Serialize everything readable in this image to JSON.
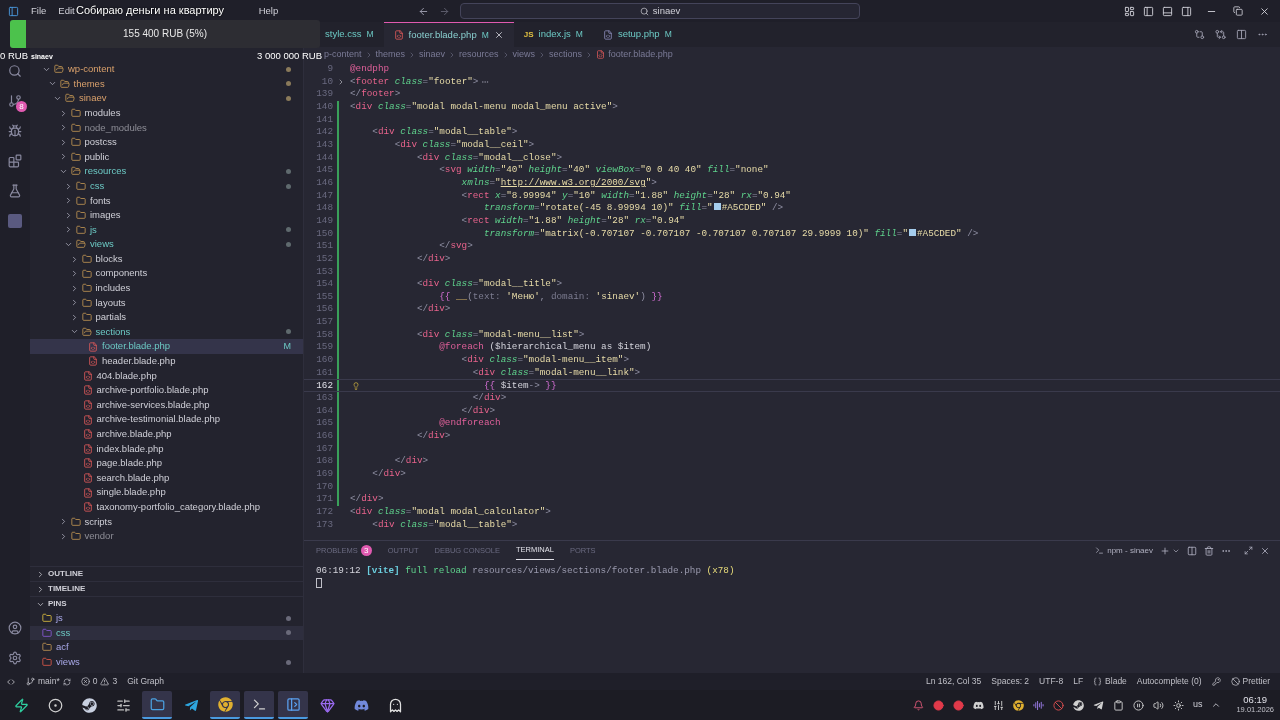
{
  "overlay": {
    "title": "Собираю деньги на квартиру",
    "amount": "155 400 RUB (5%)",
    "level": 0.05,
    "start": "0 RUB",
    "user": "sinaev",
    "goal": "3 000 000 RUB"
  },
  "menu": [
    "File",
    "Edit",
    "Help"
  ],
  "search": {
    "value": "sinaev"
  },
  "activity": {
    "scm_badge": "8"
  },
  "explorer": {
    "tree": [
      {
        "name": "wp-content",
        "kind": "folder",
        "expanded": true,
        "ignored": false,
        "modified": false,
        "contains_changes": true,
        "dot": true,
        "selected": false,
        "children": [
          {
            "name": "themes",
            "kind": "folder",
            "expanded": true,
            "ignored": false,
            "modified": false,
            "contains_changes": true,
            "dot": true,
            "selected": false,
            "children": [
              {
                "name": "sinaev",
                "kind": "folder",
                "expanded": true,
                "ignored": false,
                "modified": false,
                "contains_changes": true,
                "dot": true,
                "selected": false,
                "children": [
                  {
                    "name": "modules",
                    "kind": "folder",
                    "expanded": false,
                    "ignored": false,
                    "modified": false,
                    "contains_changes": false,
                    "dot": false,
                    "selected": false
                  },
                  {
                    "name": "node_modules",
                    "kind": "folder",
                    "expanded": false,
                    "ignored": true,
                    "modified": false,
                    "contains_changes": false,
                    "dot": false,
                    "selected": false
                  },
                  {
                    "name": "postcss",
                    "kind": "folder",
                    "expanded": false,
                    "ignored": false,
                    "modified": false,
                    "contains_changes": false,
                    "dot": false,
                    "selected": false
                  },
                  {
                    "name": "public",
                    "kind": "folder",
                    "expanded": false,
                    "ignored": false,
                    "modified": false,
                    "contains_changes": false,
                    "dot": false,
                    "selected": false
                  },
                  {
                    "name": "resources",
                    "kind": "folder",
                    "expanded": true,
                    "ignored": false,
                    "modified": true,
                    "contains_changes": false,
                    "dot": true,
                    "selected": false,
                    "children": [
                      {
                        "name": "css",
                        "kind": "folder",
                        "expanded": false,
                        "ignored": false,
                        "modified": true,
                        "contains_changes": false,
                        "dot": true,
                        "selected": false
                      },
                      {
                        "name": "fonts",
                        "kind": "folder",
                        "expanded": false,
                        "ignored": false,
                        "modified": false,
                        "contains_changes": false,
                        "dot": false,
                        "selected": false
                      },
                      {
                        "name": "images",
                        "kind": "folder",
                        "expanded": false,
                        "ignored": false,
                        "modified": false,
                        "contains_changes": false,
                        "dot": false,
                        "selected": false
                      },
                      {
                        "name": "js",
                        "kind": "folder",
                        "expanded": false,
                        "ignored": false,
                        "modified": true,
                        "contains_changes": false,
                        "dot": true,
                        "selected": false
                      },
                      {
                        "name": "views",
                        "kind": "folder",
                        "expanded": true,
                        "ignored": false,
                        "modified": true,
                        "contains_changes": false,
                        "dot": true,
                        "selected": false,
                        "children": [
                          {
                            "name": "blocks",
                            "kind": "folder",
                            "expanded": false,
                            "ignored": false,
                            "modified": false,
                            "contains_changes": false,
                            "dot": false,
                            "selected": false
                          },
                          {
                            "name": "components",
                            "kind": "folder",
                            "expanded": false,
                            "ignored": false,
                            "modified": false,
                            "contains_changes": false,
                            "dot": false,
                            "selected": false
                          },
                          {
                            "name": "includes",
                            "kind": "folder",
                            "expanded": false,
                            "ignored": false,
                            "modified": false,
                            "contains_changes": false,
                            "dot": false,
                            "selected": false
                          },
                          {
                            "name": "layouts",
                            "kind": "folder",
                            "expanded": false,
                            "ignored": false,
                            "modified": false,
                            "contains_changes": false,
                            "dot": false,
                            "selected": false
                          },
                          {
                            "name": "partials",
                            "kind": "folder",
                            "expanded": false,
                            "ignored": false,
                            "modified": false,
                            "contains_changes": false,
                            "dot": false,
                            "selected": false
                          },
                          {
                            "name": "sections",
                            "kind": "folder",
                            "expanded": true,
                            "ignored": false,
                            "modified": true,
                            "contains_changes": false,
                            "dot": true,
                            "selected": false,
                            "children": [
                              {
                                "name": "footer.blade.php",
                                "kind": "file",
                                "ignored": false,
                                "modified": true,
                                "dot": false,
                                "selected": true,
                                "badge": "M"
                              },
                              {
                                "name": "header.blade.php",
                                "kind": "file",
                                "ignored": false,
                                "modified": false,
                                "contains_changes": false,
                                "dot": false,
                                "selected": false
                              }
                            ]
                          },
                          {
                            "name": "404.blade.php",
                            "kind": "file",
                            "ignored": false,
                            "modified": false,
                            "contains_changes": false,
                            "dot": false,
                            "selected": false
                          },
                          {
                            "name": "archive-portfolio.blade.php",
                            "kind": "file",
                            "ignored": false,
                            "modified": false,
                            "contains_changes": false,
                            "dot": false,
                            "selected": false
                          },
                          {
                            "name": "archive-services.blade.php",
                            "kind": "file",
                            "ignored": false,
                            "modified": false,
                            "contains_changes": false,
                            "dot": false,
                            "selected": false
                          },
                          {
                            "name": "archive-testimonial.blade.php",
                            "kind": "file",
                            "ignored": false,
                            "modified": false,
                            "contains_changes": false,
                            "dot": false,
                            "selected": false
                          },
                          {
                            "name": "archive.blade.php",
                            "kind": "file",
                            "ignored": false,
                            "modified": false,
                            "contains_changes": false,
                            "dot": false,
                            "selected": false
                          },
                          {
                            "name": "index.blade.php",
                            "kind": "file",
                            "ignored": false,
                            "modified": false,
                            "contains_changes": false,
                            "dot": false,
                            "selected": false
                          },
                          {
                            "name": "page.blade.php",
                            "kind": "file",
                            "ignored": false,
                            "modified": false,
                            "contains_changes": false,
                            "dot": false,
                            "selected": false
                          },
                          {
                            "name": "search.blade.php",
                            "kind": "file",
                            "ignored": false,
                            "modified": false,
                            "contains_changes": false,
                            "dot": false,
                            "selected": false
                          },
                          {
                            "name": "single.blade.php",
                            "kind": "file",
                            "ignored": false,
                            "modified": false,
                            "contains_changes": false,
                            "dot": false,
                            "selected": false
                          },
                          {
                            "name": "taxonomy-portfolio_category.blade.php",
                            "kind": "file",
                            "ignored": false,
                            "modified": false,
                            "contains_changes": false,
                            "dot": false,
                            "selected": false
                          }
                        ]
                      }
                    ]
                  },
                  {
                    "name": "scripts",
                    "kind": "folder",
                    "expanded": false,
                    "ignored": false,
                    "modified": false,
                    "contains_changes": false,
                    "dot": false,
                    "selected": false
                  },
                  {
                    "name": "vendor",
                    "kind": "folder",
                    "expanded": false,
                    "ignored": true,
                    "modified": false,
                    "contains_changes": false,
                    "dot": false,
                    "selected": false
                  }
                ]
              }
            ]
          }
        ]
      }
    ]
  },
  "sections": [
    {
      "title": "OUTLINE",
      "expanded": false
    },
    {
      "title": "TIMELINE",
      "expanded": false
    },
    {
      "title": "PINS",
      "expanded": true
    }
  ],
  "pins": [
    {
      "name": "js",
      "kind": "js",
      "dot": true,
      "selected": false
    },
    {
      "name": "css",
      "kind": "css",
      "dot": true,
      "selected": true
    },
    {
      "name": "acf",
      "kind": "folder",
      "dot": false,
      "selected": false
    },
    {
      "name": "views",
      "kind": "views",
      "dot": true,
      "selected": false
    }
  ],
  "tabs": [
    {
      "label": "style.css",
      "kind": "hidden",
      "badge": "M",
      "selected": false
    },
    {
      "label": "footer.blade.php",
      "kind": "blade",
      "badge": "M",
      "selected": true
    },
    {
      "label": "index.js",
      "kind": "js",
      "icon_text": "JS",
      "badge": "M",
      "selected": false
    },
    {
      "label": "setup.php",
      "kind": "php",
      "badge": "M",
      "selected": false
    }
  ],
  "breadcrumb": [
    "p-content",
    "themes",
    "sinaev",
    "resources",
    "views",
    "sections",
    "footer.blade.php"
  ],
  "lines": [
    {
      "n": "9",
      "mod": false,
      "folded": false,
      "current": false,
      "code": [
        {
          "kind": "dir",
          "text": "@endphp"
        }
      ]
    },
    {
      "n": "10",
      "mod": false,
      "folded": true,
      "current": false,
      "code": [
        {
          "kind": "punct",
          "text": "<"
        },
        {
          "kind": "tag",
          "text": "footer"
        },
        {
          "kind": "attr",
          "text": " class"
        },
        {
          "kind": "punct",
          "text": "="
        },
        {
          "kind": "str",
          "text": "\"footer\""
        },
        {
          "kind": "punct",
          "text": ">"
        }
      ]
    },
    {
      "n": "139",
      "mod": false,
      "folded": false,
      "current": false,
      "code": [
        {
          "kind": "punct",
          "text": "</"
        },
        {
          "kind": "tag",
          "text": "footer"
        },
        {
          "kind": "punct",
          "text": ">"
        }
      ]
    },
    {
      "n": "140",
      "mod": true,
      "folded": false,
      "current": false,
      "code": [
        {
          "kind": "punct",
          "text": "<"
        },
        {
          "kind": "tag",
          "text": "div"
        },
        {
          "kind": "attr",
          "text": " class"
        },
        {
          "kind": "punct",
          "text": "="
        },
        {
          "kind": "str",
          "text": "\"modal modal-menu modal_menu active\""
        },
        {
          "kind": "punct",
          "text": ">"
        }
      ]
    },
    {
      "n": "141",
      "mod": true,
      "folded": false,
      "current": false
    },
    {
      "n": "142",
      "mod": true,
      "folded": false,
      "current": false,
      "code": [
        {
          "kind": "punct",
          "text": "    <"
        },
        {
          "kind": "tag",
          "text": "div"
        },
        {
          "kind": "attr",
          "text": " class"
        },
        {
          "kind": "punct",
          "text": "="
        },
        {
          "kind": "str",
          "text": "\"modal__table\""
        },
        {
          "kind": "punct",
          "text": ">"
        }
      ]
    },
    {
      "n": "143",
      "mod": true,
      "folded": false,
      "current": false,
      "code": [
        {
          "kind": "punct",
          "text": "        <"
        },
        {
          "kind": "tag",
          "text": "div"
        },
        {
          "kind": "attr",
          "text": " class"
        },
        {
          "kind": "punct",
          "text": "="
        },
        {
          "kind": "str",
          "text": "\"modal__ceil\""
        },
        {
          "kind": "punct",
          "text": ">"
        }
      ]
    },
    {
      "n": "144",
      "mod": true,
      "folded": false,
      "current": false,
      "code": [
        {
          "kind": "punct",
          "text": "            <"
        },
        {
          "kind": "tag",
          "text": "div"
        },
        {
          "kind": "attr",
          "text": " class"
        },
        {
          "kind": "punct",
          "text": "="
        },
        {
          "kind": "str",
          "text": "\"modal__close\""
        },
        {
          "kind": "punct",
          "text": ">"
        }
      ]
    },
    {
      "n": "145",
      "mod": true,
      "folded": false,
      "current": false,
      "code": [
        {
          "kind": "punct",
          "text": "                <"
        },
        {
          "kind": "tag",
          "text": "svg"
        },
        {
          "kind": "attr",
          "text": " width"
        },
        {
          "kind": "punct",
          "text": "="
        },
        {
          "kind": "str",
          "text": "\"40\""
        },
        {
          "kind": "attr",
          "text": " height"
        },
        {
          "kind": "punct",
          "text": "="
        },
        {
          "kind": "str",
          "text": "\"40\""
        },
        {
          "kind": "attr",
          "text": " viewBox"
        },
        {
          "kind": "punct",
          "text": "="
        },
        {
          "kind": "str",
          "text": "\"0 0 40 40\""
        },
        {
          "kind": "attr",
          "text": " fill"
        },
        {
          "kind": "punct",
          "text": "="
        },
        {
          "kind": "str",
          "text": "\"none\""
        }
      ]
    },
    {
      "n": "146",
      "mod": true,
      "folded": false,
      "current": false,
      "code": [
        {
          "kind": "attr",
          "text": "                    xmlns"
        },
        {
          "kind": "punct",
          "text": "="
        },
        {
          "kind": "str",
          "text": "\""
        },
        {
          "kind": "url",
          "text": "http://www.w3.org/2000/svg"
        },
        {
          "kind": "str",
          "text": "\""
        },
        {
          "kind": "punct",
          "text": ">"
        }
      ]
    },
    {
      "n": "147",
      "mod": true,
      "folded": false,
      "current": false,
      "code": [
        {
          "kind": "punct",
          "text": "                    <"
        },
        {
          "kind": "tag",
          "text": "rect"
        },
        {
          "kind": "attr",
          "text": " x"
        },
        {
          "kind": "punct",
          "text": "="
        },
        {
          "kind": "str",
          "text": "\"8.99994\""
        },
        {
          "kind": "attr",
          "text": " y"
        },
        {
          "kind": "punct",
          "text": "="
        },
        {
          "kind": "str",
          "text": "\"10\""
        },
        {
          "kind": "attr",
          "text": " width"
        },
        {
          "kind": "punct",
          "text": "="
        },
        {
          "kind": "str",
          "text": "\"1.88\""
        },
        {
          "kind": "attr",
          "text": " height"
        },
        {
          "kind": "punct",
          "text": "="
        },
        {
          "kind": "str",
          "text": "\"28\""
        },
        {
          "kind": "attr",
          "text": " rx"
        },
        {
          "kind": "punct",
          "text": "="
        },
        {
          "kind": "str",
          "text": "\"0.94\""
        }
      ]
    },
    {
      "n": "148",
      "mod": true,
      "folded": false,
      "current": false,
      "code": [
        {
          "kind": "attr",
          "text": "                        transform"
        },
        {
          "kind": "punct",
          "text": "="
        },
        {
          "kind": "str",
          "text": "\"rotate(-45 8.99994 10)\""
        },
        {
          "kind": "attr",
          "text": " fill"
        },
        {
          "kind": "punct",
          "text": "="
        },
        {
          "kind": "str",
          "text": "\""
        },
        {
          "kind": "swatch",
          "color": "#a5cded"
        },
        {
          "kind": "str",
          "text": "#A5CDED\""
        },
        {
          "kind": "punct",
          "text": " />"
        }
      ]
    },
    {
      "n": "149",
      "mod": true,
      "folded": false,
      "current": false,
      "code": [
        {
          "kind": "punct",
          "text": "                    <"
        },
        {
          "kind": "tag",
          "text": "rect"
        },
        {
          "kind": "attr",
          "text": " width"
        },
        {
          "kind": "punct",
          "text": "="
        },
        {
          "kind": "str",
          "text": "\"1.88\""
        },
        {
          "kind": "attr",
          "text": " height"
        },
        {
          "kind": "punct",
          "text": "="
        },
        {
          "kind": "str",
          "text": "\"28\""
        },
        {
          "kind": "attr",
          "text": " rx"
        },
        {
          "kind": "punct",
          "text": "="
        },
        {
          "kind": "str",
          "text": "\"0.94\""
        }
      ]
    },
    {
      "n": "150",
      "mod": true,
      "folded": false,
      "current": false,
      "code": [
        {
          "kind": "attr",
          "text": "                        transform"
        },
        {
          "kind": "punct",
          "text": "="
        },
        {
          "kind": "str",
          "text": "\"matrix(-0.707107 -0.707107 -0.707107 0.707107 29.9999 10)\""
        },
        {
          "kind": "attr",
          "text": " fill"
        },
        {
          "kind": "punct",
          "text": "="
        },
        {
          "kind": "str",
          "text": "\""
        },
        {
          "kind": "swatch",
          "color": "#a5cded"
        },
        {
          "kind": "str",
          "text": "#A5CDED\""
        },
        {
          "kind": "punct",
          "text": " />"
        }
      ]
    },
    {
      "n": "151",
      "mod": true,
      "folded": false,
      "current": false,
      "code": [
        {
          "kind": "punct",
          "text": "                </"
        },
        {
          "kind": "tag",
          "text": "svg"
        },
        {
          "kind": "punct",
          "text": ">"
        }
      ]
    },
    {
      "n": "152",
      "mod": true,
      "folded": false,
      "current": false,
      "code": [
        {
          "kind": "punct",
          "text": "            </"
        },
        {
          "kind": "tag",
          "text": "div"
        },
        {
          "kind": "punct",
          "text": ">"
        }
      ]
    },
    {
      "n": "153",
      "mod": true,
      "folded": false,
      "current": false
    },
    {
      "n": "154",
      "mod": true,
      "folded": false,
      "current": false,
      "code": [
        {
          "kind": "punct",
          "text": "            <"
        },
        {
          "kind": "tag",
          "text": "div"
        },
        {
          "kind": "attr",
          "text": " class"
        },
        {
          "kind": "punct",
          "text": "="
        },
        {
          "kind": "str",
          "text": "\"modal__title\""
        },
        {
          "kind": "punct",
          "text": ">"
        }
      ]
    },
    {
      "n": "155",
      "mod": true,
      "folded": false,
      "current": false,
      "code": [
        {
          "kind": "brace",
          "text": "                {{ "
        },
        {
          "kind": "fn",
          "text": "__"
        },
        {
          "kind": "punct",
          "text": "("
        },
        {
          "kind": "key",
          "text": "text:"
        },
        {
          "kind": "str",
          "text": " 'Меню'"
        },
        {
          "kind": "punct",
          "text": ", "
        },
        {
          "kind": "key",
          "text": "domain:"
        },
        {
          "kind": "str",
          "text": " 'sinaev'"
        },
        {
          "kind": "punct",
          "text": ")"
        },
        {
          "kind": "brace",
          "text": " }}"
        }
      ]
    },
    {
      "n": "156",
      "mod": true,
      "folded": false,
      "current": false,
      "code": [
        {
          "kind": "punct",
          "text": "            </"
        },
        {
          "kind": "tag",
          "text": "div"
        },
        {
          "kind": "punct",
          "text": ">"
        }
      ]
    },
    {
      "n": "157",
      "mod": true,
      "folded": false,
      "current": false
    },
    {
      "n": "158",
      "mod": true,
      "folded": false,
      "current": false,
      "code": [
        {
          "kind": "punct",
          "text": "            <"
        },
        {
          "kind": "tag",
          "text": "div"
        },
        {
          "kind": "attr",
          "text": " class"
        },
        {
          "kind": "punct",
          "text": "="
        },
        {
          "kind": "str",
          "text": "\"modal-menu__list\""
        },
        {
          "kind": "punct",
          "text": ">"
        }
      ]
    },
    {
      "n": "159",
      "mod": true,
      "folded": false,
      "current": false,
      "code": [
        {
          "kind": "dir",
          "text": "                @foreach"
        },
        {
          "kind": "plain",
          "text": " ($hierarchical_menu as $item)"
        }
      ]
    },
    {
      "n": "160",
      "mod": true,
      "folded": false,
      "current": false,
      "code": [
        {
          "kind": "punct",
          "text": "                    <"
        },
        {
          "kind": "tag",
          "text": "div"
        },
        {
          "kind": "attr",
          "text": " class"
        },
        {
          "kind": "punct",
          "text": "="
        },
        {
          "kind": "str",
          "text": "\"modal-menu__item\""
        },
        {
          "kind": "punct",
          "text": ">"
        }
      ]
    },
    {
      "n": "161",
      "mod": true,
      "folded": false,
      "current": false,
      "code": [
        {
          "kind": "punct",
          "text": "                      <"
        },
        {
          "kind": "tag",
          "text": "div"
        },
        {
          "kind": "attr",
          "text": " class"
        },
        {
          "kind": "punct",
          "text": "="
        },
        {
          "kind": "str",
          "text": "\"modal-menu__link\""
        },
        {
          "kind": "punct",
          "text": ">"
        }
      ]
    },
    {
      "n": "162",
      "mod": true,
      "folded": false,
      "current": true,
      "code": [
        {
          "kind": "brace",
          "text": "                        {{ "
        },
        {
          "kind": "var",
          "text": "$item"
        },
        {
          "kind": "punct",
          "text": "-> "
        },
        {
          "kind": "brace",
          "text": "}}"
        }
      ]
    },
    {
      "n": "163",
      "mod": true,
      "folded": false,
      "current": false,
      "code": [
        {
          "kind": "punct",
          "text": "                      </"
        },
        {
          "kind": "tag",
          "text": "div"
        },
        {
          "kind": "punct",
          "text": ">"
        }
      ]
    },
    {
      "n": "164",
      "mod": true,
      "folded": false,
      "current": false,
      "code": [
        {
          "kind": "punct",
          "text": "                    </"
        },
        {
          "kind": "tag",
          "text": "div"
        },
        {
          "kind": "punct",
          "text": ">"
        }
      ]
    },
    {
      "n": "165",
      "mod": true,
      "folded": false,
      "current": false,
      "code": [
        {
          "kind": "dir",
          "text": "                @endforeach"
        }
      ]
    },
    {
      "n": "166",
      "mod": true,
      "folded": false,
      "current": false,
      "code": [
        {
          "kind": "punct",
          "text": "            </"
        },
        {
          "kind": "tag",
          "text": "div"
        },
        {
          "kind": "punct",
          "text": ">"
        }
      ]
    },
    {
      "n": "167",
      "mod": true,
      "folded": false,
      "current": false
    },
    {
      "n": "168",
      "mod": true,
      "folded": false,
      "current": false,
      "code": [
        {
          "kind": "punct",
          "text": "        </"
        },
        {
          "kind": "tag",
          "text": "div"
        },
        {
          "kind": "punct",
          "text": ">"
        }
      ]
    },
    {
      "n": "169",
      "mod": true,
      "folded": false,
      "current": false,
      "code": [
        {
          "kind": "punct",
          "text": "    </"
        },
        {
          "kind": "tag",
          "text": "div"
        },
        {
          "kind": "punct",
          "text": ">"
        }
      ]
    },
    {
      "n": "170",
      "mod": true,
      "folded": false,
      "current": false
    },
    {
      "n": "171",
      "mod": true,
      "folded": false,
      "current": false,
      "code": [
        {
          "kind": "punct",
          "text": "</"
        },
        {
          "kind": "tag",
          "text": "div"
        },
        {
          "kind": "punct",
          "text": ">"
        }
      ]
    },
    {
      "n": "172",
      "mod": false,
      "folded": false,
      "current": false,
      "code": [
        {
          "kind": "punct",
          "text": "<"
        },
        {
          "kind": "tag",
          "text": "div"
        },
        {
          "kind": "attr",
          "text": " class"
        },
        {
          "kind": "punct",
          "text": "="
        },
        {
          "kind": "str",
          "text": "\"modal modal_calculator\""
        },
        {
          "kind": "punct",
          "text": ">"
        }
      ]
    },
    {
      "n": "173",
      "mod": false,
      "folded": false,
      "current": false,
      "code": [
        {
          "kind": "punct",
          "text": "    <"
        },
        {
          "kind": "tag",
          "text": "div"
        },
        {
          "kind": "attr",
          "text": " class"
        },
        {
          "kind": "punct",
          "text": "="
        },
        {
          "kind": "str",
          "text": "\"modal__table\""
        },
        {
          "kind": "punct",
          "text": ">"
        }
      ]
    }
  ],
  "panel": {
    "tabs": [
      {
        "label": "PROBLEMS",
        "badge": "3",
        "selected": false
      },
      {
        "label": "OUTPUT",
        "selected": false
      },
      {
        "label": "DEBUG CONSOLE",
        "selected": false
      },
      {
        "label": "TERMINAL",
        "selected": true
      },
      {
        "label": "PORTS",
        "selected": false
      }
    ],
    "terminal_name": "npm - sinaev",
    "output": [
      {
        "kind": "time",
        "text": "06:19:12"
      },
      {
        "kind": "tag",
        "text": "[vite]"
      },
      {
        "kind": "action",
        "text": "full reload"
      },
      {
        "kind": "path",
        "text": "resources/views/sections/footer.blade.php"
      },
      {
        "kind": "count",
        "text": "(x78)"
      }
    ]
  },
  "status": {
    "branch": "main*",
    "errors": "0",
    "warnings": "3",
    "extension": "Git Graph",
    "right": [
      {
        "kind": "plain",
        "text": "Ln 162, Col 35"
      },
      {
        "kind": "plain",
        "text": "Spaces: 2"
      },
      {
        "kind": "plain",
        "text": "UTF-8"
      },
      {
        "kind": "plain",
        "text": "LF"
      },
      {
        "kind": "language",
        "text": "Blade"
      },
      {
        "kind": "plain",
        "text": "Autocomplete (0)"
      },
      {
        "kind": "key"
      },
      {
        "kind": "formatter",
        "text": "Prettier"
      }
    ]
  },
  "taskbar": {
    "apps": [
      {
        "kind": "launcher",
        "active": false
      },
      {
        "kind": "obs",
        "active": false
      },
      {
        "kind": "steam",
        "active": false
      },
      {
        "kind": "mixer",
        "active": false
      },
      {
        "kind": "files",
        "active": true
      },
      {
        "kind": "telegram",
        "active": false
      },
      {
        "kind": "chrome",
        "active": true
      },
      {
        "kind": "terminal",
        "active": true
      },
      {
        "kind": "editor",
        "active": true
      },
      {
        "kind": "gem",
        "active": false
      },
      {
        "kind": "discord",
        "active": false
      },
      {
        "kind": "ghost",
        "active": false
      }
    ],
    "tray": [
      {
        "kind": "bell"
      },
      {
        "kind": "record"
      },
      {
        "kind": "record"
      },
      {
        "kind": "discord"
      },
      {
        "kind": "mixer"
      },
      {
        "kind": "chrome"
      },
      {
        "kind": "meter"
      },
      {
        "kind": "blocked"
      },
      {
        "kind": "steam"
      },
      {
        "kind": "telegram"
      },
      {
        "kind": "clipboard"
      },
      {
        "kind": "media"
      },
      {
        "kind": "volume"
      },
      {
        "kind": "brightness"
      }
    ],
    "keyboard": "us",
    "time": "06:19",
    "date": "19.01.2026"
  }
}
